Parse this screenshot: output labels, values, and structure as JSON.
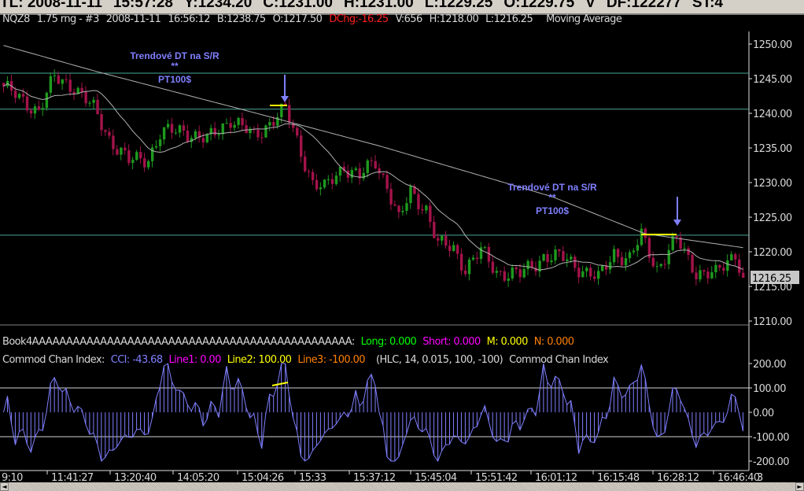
{
  "topbar": {
    "items": [
      "TL: 2008-11-11",
      "15:57:28",
      "Y:1234.20",
      "C:1231.00",
      "H:1231.00",
      "L:1229.25",
      "O:1229.75",
      "V",
      "DF:122277",
      "ST:4"
    ]
  },
  "info": {
    "symbol": "NQZ8",
    "interval": "1.75 rng - #3",
    "date": "2008-11-11",
    "time": "16:56:12",
    "bid": "B:1238.75",
    "open": "O:1217.50",
    "dchg": "DChg:-16.25",
    "volume": "V:656",
    "high": "H:1218.00",
    "low": "L:1216.25",
    "study": "Moving Average"
  },
  "book": {
    "name": "Book4AAAAAAAAAAAAAAAAAAAAAAAAAAAAAAAAAAAAAAAAAAAAAAA:",
    "long": "Long: 0.000",
    "short": "Short: 0.000",
    "m": "M: 0.000",
    "n": "N: 0.000"
  },
  "cci_header": {
    "name": "Commod Chan Index:",
    "cci": "CCI: -43.68",
    "line1": "Line1: 0.00",
    "line2": "Line2: 100.00",
    "line3": "Line3: -100.00",
    "params": "(HLC, 14, 0.015, 100, -100)",
    "name2": "Commod Chan Index"
  },
  "annotations": [
    {
      "title": "Trendové DT na S/R",
      "stars": "**",
      "target": "PT100$"
    },
    {
      "title": "Trendové DT na S/R",
      "stars": "**",
      "target": "PT100$"
    }
  ],
  "colors": {
    "up": "#1e9a1e",
    "down": "#a3134a",
    "annotation": "#7f7fff",
    "sr_line": "#4aa79a",
    "highlight": "#ffff00",
    "cci": "#7f7fff"
  },
  "chart_data": [
    {
      "type": "candlestick",
      "price_axis_ticks": [
        "1250.00",
        "1245.00",
        "1240.00",
        "1235.00",
        "1230.00",
        "1225.00",
        "1220.00",
        "1215.00",
        "1210.00"
      ],
      "ylim": [
        1209,
        1252
      ],
      "last_price": "1216.25",
      "bar_count": 190,
      "close_path": [
        [
          0,
          1243.9
        ],
        [
          4,
          1242
        ],
        [
          9,
          1240.5
        ],
        [
          13,
          1245
        ],
        [
          18,
          1244
        ],
        [
          23,
          1240.5
        ],
        [
          27,
          1236.5
        ],
        [
          32,
          1233
        ],
        [
          37,
          1233.6
        ],
        [
          40,
          1237
        ],
        [
          46,
          1237.6
        ],
        [
          52,
          1236
        ],
        [
          58,
          1239.3
        ],
        [
          64,
          1236.5
        ],
        [
          69,
          1239.3
        ],
        [
          72,
          1240.5
        ],
        [
          75,
          1236
        ],
        [
          79,
          1230
        ],
        [
          82,
          1229
        ],
        [
          87,
          1232.5
        ],
        [
          91,
          1230.8
        ],
        [
          95,
          1233
        ],
        [
          98,
          1229.7
        ],
        [
          101,
          1224.5
        ],
        [
          104,
          1228.5
        ],
        [
          108,
          1226.3
        ],
        [
          111,
          1221
        ],
        [
          115,
          1220.5
        ],
        [
          118,
          1217.7
        ],
        [
          122,
          1220
        ],
        [
          126,
          1217.2
        ],
        [
          132,
          1216.6
        ],
        [
          138,
          1219.4
        ],
        [
          144,
          1218.9
        ],
        [
          152,
          1216
        ],
        [
          156,
          1220
        ],
        [
          160,
          1218.9
        ],
        [
          163,
          1222.3
        ],
        [
          167,
          1217.7
        ],
        [
          172,
          1221.7
        ],
        [
          177,
          1217.2
        ],
        [
          182,
          1216.6
        ],
        [
          187,
          1220
        ],
        [
          189,
          1216.25
        ]
      ],
      "ma_slow_path": [
        [
          0,
          1249.8
        ],
        [
          24,
          1246
        ],
        [
          60,
          1240.7
        ],
        [
          96,
          1235.3
        ],
        [
          140,
          1228
        ],
        [
          164,
          1222.6
        ],
        [
          189,
          1220.6
        ]
      ],
      "sr_levels": [
        1245.8,
        1240.6,
        1222.4
      ],
      "time_labels": [
        "9:10",
        "11:41:27",
        "13:20:40",
        "14:05:20",
        "15:04:26",
        "15:33",
        "15:37:12",
        "15:45:04",
        "15:51:42",
        "16:01:12",
        "16:15:48",
        "16:28:12",
        "16:46:40",
        "3"
      ]
    },
    {
      "type": "bar",
      "name": "Commod Chan Index",
      "axis_ticks": [
        "200.00",
        "100.00",
        "0.00",
        "-100.00",
        "-200.00"
      ],
      "ylim": [
        -200,
        200
      ],
      "levels": [
        100,
        0,
        -100
      ]
    }
  ]
}
